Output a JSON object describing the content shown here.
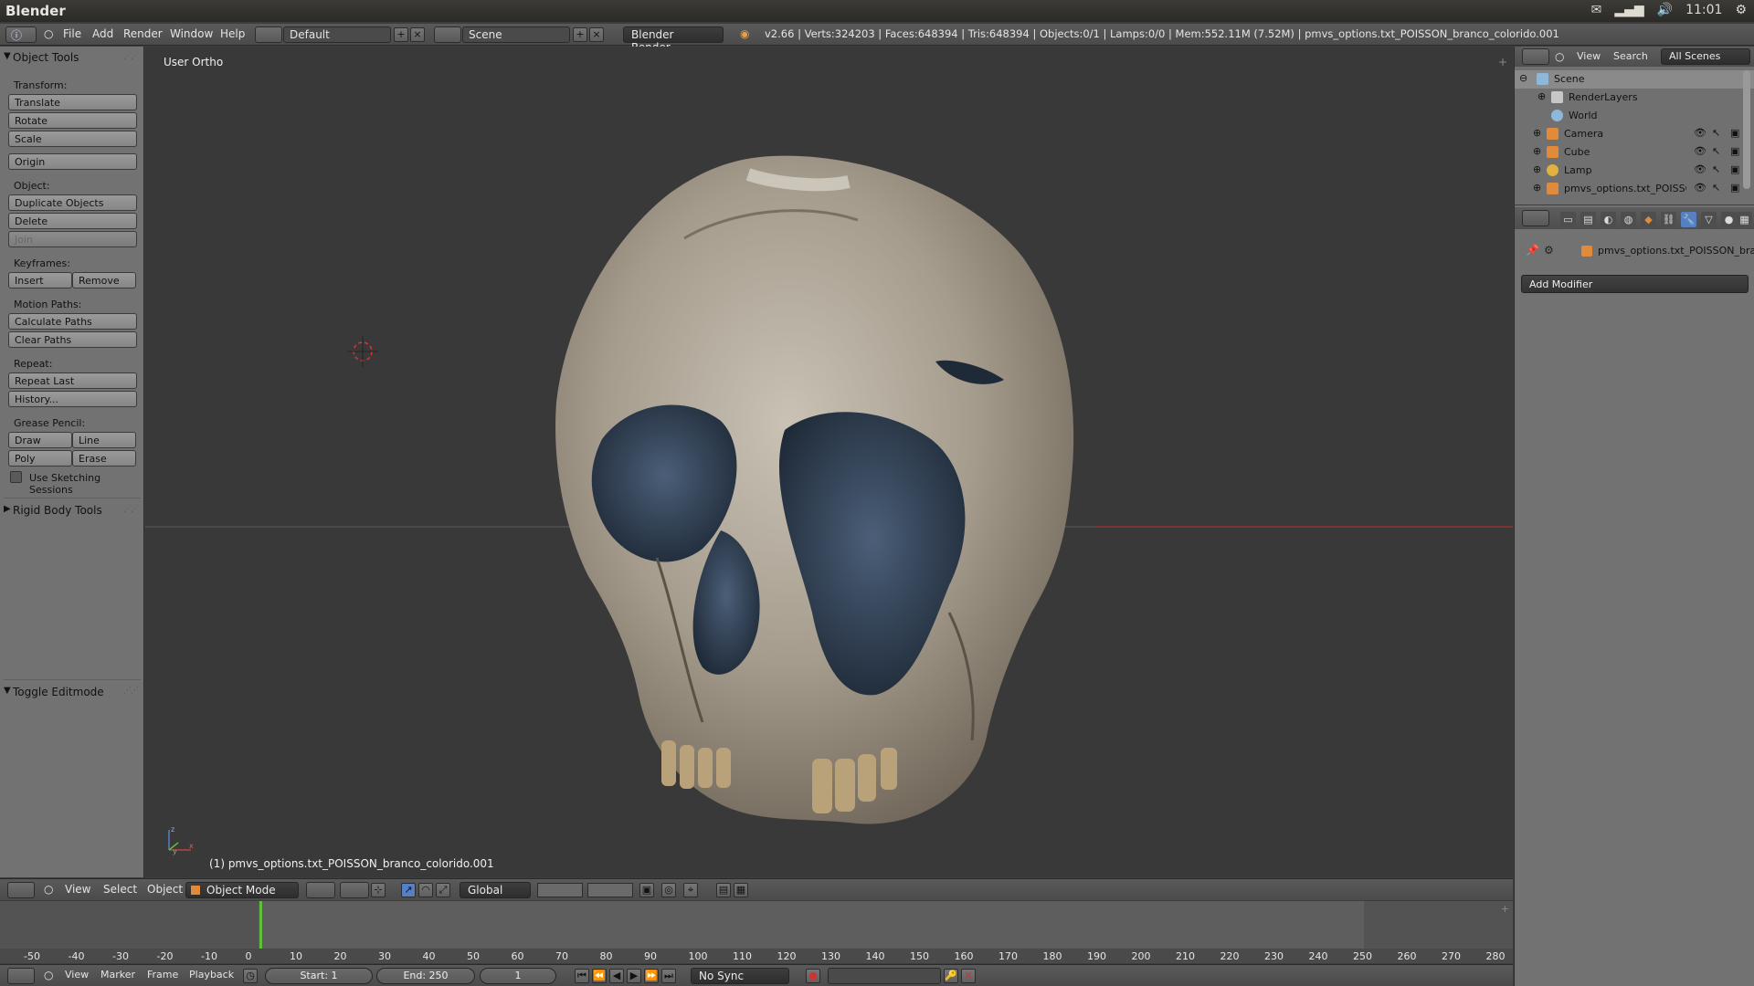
{
  "os_bar": {
    "title": "Blender",
    "clock": "11:01"
  },
  "info_header": {
    "menus": [
      "File",
      "Add",
      "Render",
      "Window",
      "Help"
    ],
    "screen_layout": "Default",
    "scene": "Scene",
    "render_engine": "Blender Render",
    "stats": "v2.66 | Verts:324203 | Faces:648394 | Tris:648394 | Objects:0/1 | Lamps:0/0 | Mem:552.11M (7.52M) | pmvs_options.txt_POISSON_branco_colorido.001"
  },
  "tool_shelf": {
    "object_tools_title": "Object Tools",
    "transform_label": "Transform:",
    "translate": "Translate",
    "rotate": "Rotate",
    "scale": "Scale",
    "origin": "Origin",
    "object_label": "Object:",
    "duplicate": "Duplicate Objects",
    "delete": "Delete",
    "join": "Join",
    "keyframes_label": "Keyframes:",
    "insert": "Insert",
    "remove": "Remove",
    "motion_paths_label": "Motion Paths:",
    "calculate_paths": "Calculate Paths",
    "clear_paths": "Clear Paths",
    "repeat_label": "Repeat:",
    "repeat_last": "Repeat Last",
    "history": "History...",
    "grease_pencil_label": "Grease Pencil:",
    "draw": "Draw",
    "line": "Line",
    "poly": "Poly",
    "erase": "Erase",
    "use_sketching": "Use Sketching Sessions",
    "rigid_body_title": "Rigid Body Tools",
    "toggle_editmode_title": "Toggle Editmode"
  },
  "viewport": {
    "view_label": "User Ortho",
    "object_label": "(1) pmvs_options.txt_POISSON_branco_colorido.001"
  },
  "outliner": {
    "view": "View",
    "search": "Search",
    "filter": "All Scenes",
    "rows": [
      {
        "label": "Scene",
        "color": "#8fb8d8"
      },
      {
        "label": "RenderLayers",
        "color": "#c7c7c7"
      },
      {
        "label": "World",
        "color": "#8fb8d8"
      },
      {
        "label": "Camera",
        "color": "#e08a3a"
      },
      {
        "label": "Cube",
        "color": "#e08a3a"
      },
      {
        "label": "Lamp",
        "color": "#e0b040"
      },
      {
        "label": "pmvs_options.txt_POISSO",
        "color": "#e08a3a"
      }
    ]
  },
  "properties": {
    "object_name": "pmvs_options.txt_POISSON_bran",
    "add_modifier": "Add Modifier"
  },
  "view3d_header": {
    "menus": [
      "View",
      "Select",
      "Object"
    ],
    "mode": "Object Mode",
    "orientation": "Global"
  },
  "timeline": {
    "ticks": [
      "-50",
      "-40",
      "-30",
      "-20",
      "-10",
      "0",
      "10",
      "20",
      "30",
      "40",
      "50",
      "60",
      "70",
      "80",
      "90",
      "100",
      "110",
      "120",
      "130",
      "140",
      "150",
      "160",
      "170",
      "180",
      "190",
      "200",
      "210",
      "220",
      "230",
      "240",
      "250",
      "260",
      "270",
      "280"
    ],
    "menus": [
      "View",
      "Marker",
      "Frame",
      "Playback"
    ],
    "start": "Start: 1",
    "end": "End: 250",
    "current_frame": "1",
    "sync": "No Sync"
  },
  "colors": {
    "accent_blue": "#5680c2",
    "timeline_cursor": "#5fbf3b",
    "x_axis": "#7a3535"
  }
}
